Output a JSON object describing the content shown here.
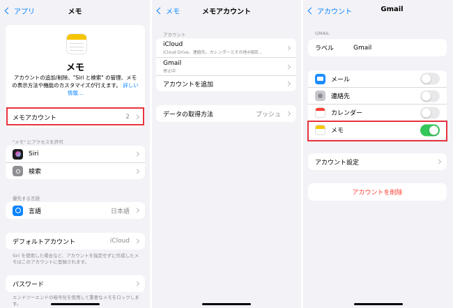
{
  "panel1": {
    "back_label": "アプリ",
    "title": "メモ",
    "app_name": "メモ",
    "description": "アカウントの追加/削除、\"Siri と検索\" の管理、メモの表示方法や機能のカスタマイズが行えます。",
    "more_link": "詳しい情報...",
    "notes_account": {
      "label": "メモアカウント",
      "value": "2"
    },
    "access_section": "\"メモ\" にアクセスを許可",
    "access_items": [
      {
        "label": "Siri"
      },
      {
        "label": "検索"
      }
    ],
    "language_section": "優先する言語",
    "language": {
      "label": "言語",
      "value": "日本語"
    },
    "default_account": {
      "label": "デフォルトアカウント",
      "value": "iCloud"
    },
    "default_account_footer": "Siri を使用した場合など、アカウントを指定せずに作成したメモはこのアカウントに登録されます。",
    "password": {
      "label": "パスワード"
    },
    "password_footer": "エンドツーエンドの暗号化を使用して重要なメモをロックします。"
  },
  "panel2": {
    "back_label": "メモ",
    "title": "メモアカウント",
    "section": "アカウント",
    "accounts": [
      {
        "name": "iCloud",
        "detail": "iCloud Drive、連絡先、カレンダーとその他4項目..."
      },
      {
        "name": "Gmail",
        "detail": "停止中"
      }
    ],
    "add_account": "アカウントを追加",
    "fetch": {
      "label": "データの取得方法",
      "value": "プッシュ"
    }
  },
  "panel3": {
    "back_label": "アカウント",
    "title": "Gmail",
    "section": "GMAIL",
    "label_row": {
      "label": "ラベル",
      "value": "Gmail"
    },
    "services": [
      {
        "label": "メール",
        "on": false
      },
      {
        "label": "連絡先",
        "on": false
      },
      {
        "label": "カレンダー",
        "on": false
      },
      {
        "label": "メモ",
        "on": true
      }
    ],
    "account_settings": "アカウント設定",
    "delete_account": "アカウントを削除"
  },
  "colors": {
    "accent": "#0a84ff",
    "highlight": "#e8323c",
    "toggle_on": "#34c759",
    "destructive": "#ff3b30"
  }
}
